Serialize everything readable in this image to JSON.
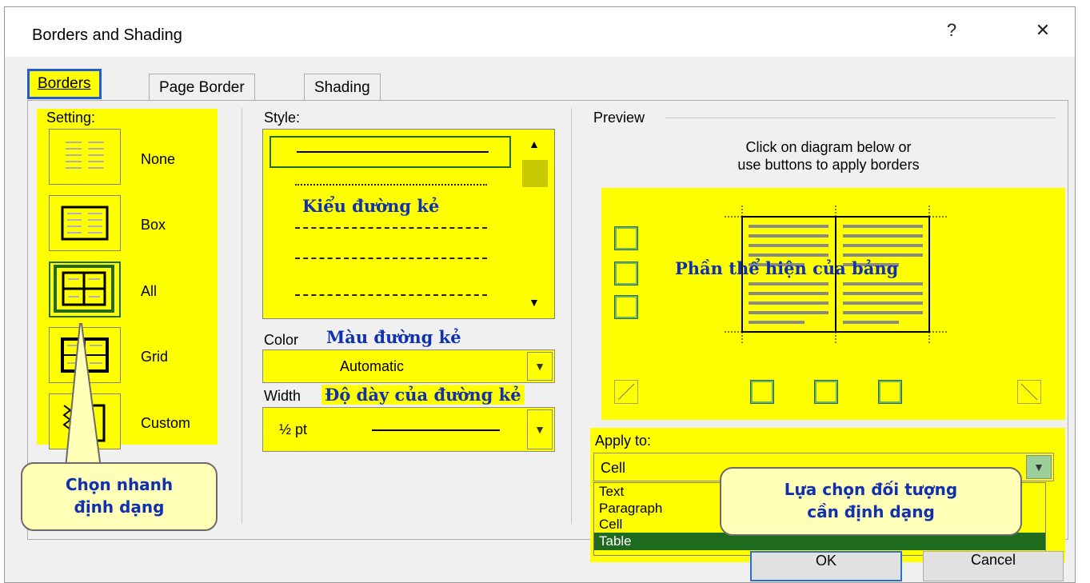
{
  "window": {
    "title": "Borders and Shading",
    "help_label": "?",
    "close_label": "✕"
  },
  "tabs": [
    {
      "label": "Borders",
      "mnemonic": "B",
      "active": true
    },
    {
      "label": "Page Border",
      "mnemonic": "P",
      "active": false
    },
    {
      "label": "Shading",
      "mnemonic": "S",
      "active": false
    }
  ],
  "setting": {
    "label": "Setting:",
    "options": [
      {
        "label": "None",
        "mnemonic": "N"
      },
      {
        "label": "Box",
        "mnemonic": "x"
      },
      {
        "label": "All",
        "mnemonic": "A"
      },
      {
        "label": "Grid",
        "mnemonic": "d"
      },
      {
        "label": "Custom",
        "mnemonic": "u"
      }
    ],
    "selected": "All"
  },
  "style": {
    "label": "Style:"
  },
  "color": {
    "label": "Color",
    "value": "Automatic"
  },
  "width": {
    "label": "Width",
    "value": "½ pt"
  },
  "preview": {
    "label": "Preview",
    "instructions_line1": "Click on diagram below or",
    "instructions_line2": "use buttons to apply borders"
  },
  "apply_to": {
    "label": "Apply to:",
    "value": "Cell",
    "options": [
      "Text",
      "Paragraph",
      "Cell",
      "Table"
    ],
    "highlighted": "Table"
  },
  "buttons": {
    "ok": "OK",
    "cancel": "Cancel"
  },
  "annotations": {
    "line_style": "Kiểu đường kẻ",
    "line_color": "Màu đường kẻ",
    "line_width": "Độ dày của đường kẻ",
    "table_preview": "Phần thể hiện của bảng",
    "quick_format_line1": "Chọn nhanh",
    "quick_format_line2": "định dạng",
    "apply_target_line1": "Lựa chọn đối tượng",
    "apply_target_line2": "cần định dạng"
  },
  "colors": {
    "highlight": "#ffff00",
    "tab_outline": "#1e5bd8",
    "selection": "#1e6b1e",
    "annotation_text": "#1030b0"
  }
}
